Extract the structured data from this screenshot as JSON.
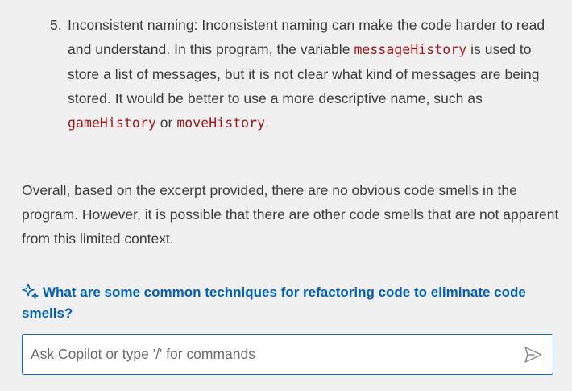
{
  "list": {
    "number": "5.",
    "segments": [
      {
        "type": "text",
        "value": "Inconsistent naming: Inconsistent naming can make the code harder to read and understand. In this program, the variable "
      },
      {
        "type": "code",
        "value": "messageHistory"
      },
      {
        "type": "text",
        "value": " is used to store a list of messages, but it is not clear what kind of messages are being stored. It would be better to use a more descriptive name, such as "
      },
      {
        "type": "code",
        "value": "gameHistory"
      },
      {
        "type": "text",
        "value": " or "
      },
      {
        "type": "code",
        "value": "moveHistory"
      },
      {
        "type": "text",
        "value": "."
      }
    ]
  },
  "summary": "Overall, based on the excerpt provided, there are no obvious code smells in the program. However, it is possible that there are other code smells that are not apparent from this limited context.",
  "followup": {
    "icon": "sparkle-icon",
    "text": "What are some common techniques for refactoring code to eliminate code smells?"
  },
  "input": {
    "placeholder": "Ask Copilot or type '/' for commands",
    "value": "",
    "send_icon": "send-icon"
  },
  "colors": {
    "background": "#f0f0f0",
    "text": "#3b3b3b",
    "code": "#a31515",
    "link": "#005fb8",
    "input_border": "#0f6cbd"
  }
}
